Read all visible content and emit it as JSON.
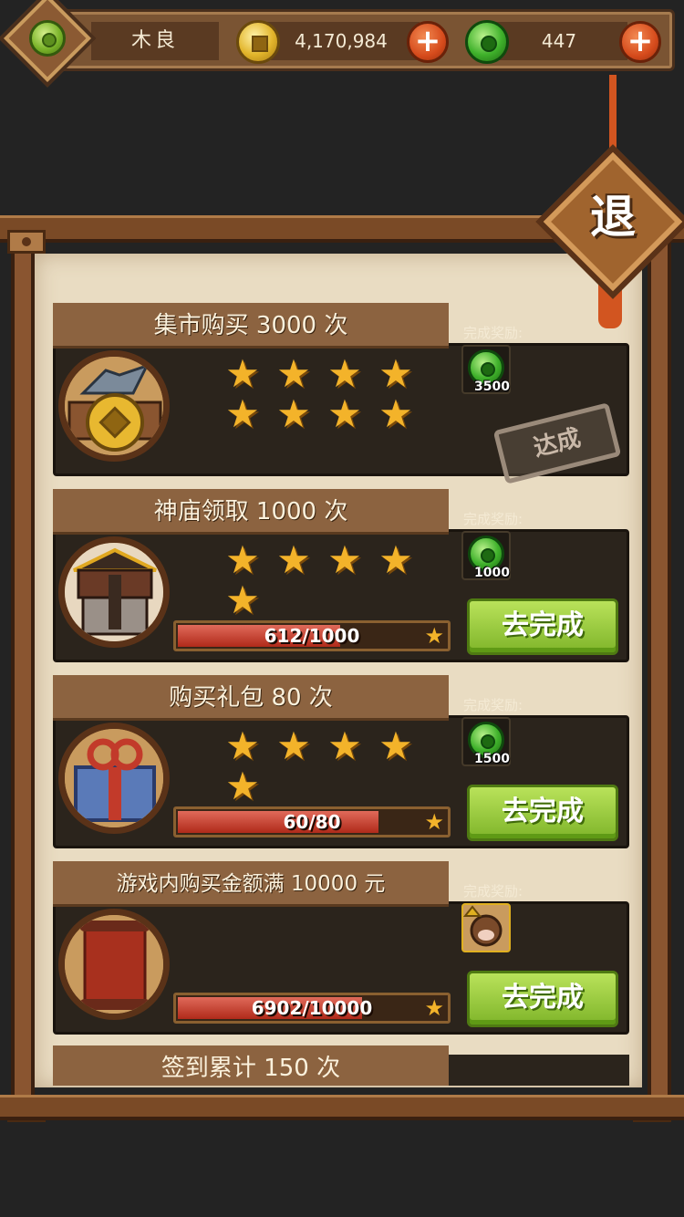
{
  "header": {
    "player_name": "木良",
    "gold": "4,170,984",
    "jade": "447"
  },
  "exit_label": "退",
  "reward_label": "完成奖励:",
  "tasks": [
    {
      "title": "集市购买 3000 次",
      "stars": 8,
      "reward_qty": "3500",
      "status": "达成",
      "progress": ""
    },
    {
      "title": "神庙领取 1000 次",
      "stars": 5,
      "reward_qty": "1000",
      "progress": "612/1000",
      "progress_fraction": 0.612,
      "button": "去完成"
    },
    {
      "title": "购买礼包 80 次",
      "stars": 5,
      "reward_qty": "1500",
      "progress": "60/80",
      "progress_fraction": 0.75,
      "button": "去完成"
    },
    {
      "title": "游戏内购买金额满 10000 元",
      "stars": 0,
      "reward_qty": "",
      "progress": "6902/10000",
      "progress_fraction": 0.6902,
      "button": "去完成"
    }
  ],
  "cut_task_title": "签到累计 150 次",
  "colors": {
    "accent_green": "#7fb52a",
    "star": "#f3b32a",
    "wood": "#7a4a26"
  }
}
